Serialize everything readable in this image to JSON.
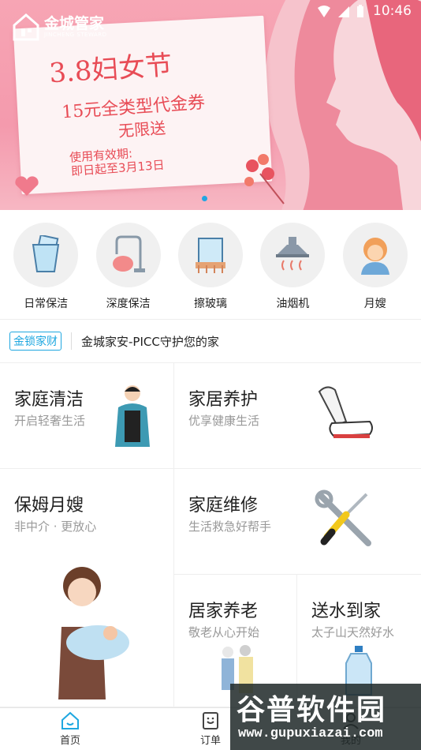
{
  "status_bar": {
    "time": "10:46"
  },
  "banner": {
    "logo_text": "金城管家",
    "logo_sub": "JINCHENG STEWARD",
    "title": "3.8妇女节",
    "line1": "15元全类型代金券",
    "line2": "无限送",
    "valid_label": "使用有效期:",
    "valid_range": "即日起至3月13日"
  },
  "categories": [
    {
      "label": "日常保洁",
      "icon": "glass-cup-icon"
    },
    {
      "label": "深度保洁",
      "icon": "vacuum-cleaner-icon"
    },
    {
      "label": "擦玻璃",
      "icon": "window-icon"
    },
    {
      "label": "油烟机",
      "icon": "range-hood-icon"
    },
    {
      "label": "月嫂",
      "icon": "nanny-avatar-icon"
    }
  ],
  "notice": {
    "badge": "金锁家财",
    "text": "金城家安-PICC守护您的家"
  },
  "services": {
    "home_cleaning": {
      "title": "家庭清洁",
      "sub": "开启轻奢生活"
    },
    "home_care": {
      "title": "家居养护",
      "sub": "优享健康生活"
    },
    "nanny": {
      "title": "保姆月嫂",
      "sub": "非中介 · 更放心"
    },
    "repair": {
      "title": "家庭维修",
      "sub": "生活救急好帮手"
    },
    "elderly": {
      "title": "居家养老",
      "sub": "敬老从心开始"
    },
    "water": {
      "title": "送水到家",
      "sub": "太子山天然好水"
    }
  },
  "tabs": [
    {
      "label": "首页",
      "icon": "home-icon"
    },
    {
      "label": "订单",
      "icon": "order-icon"
    },
    {
      "label": "我的",
      "icon": "user-icon"
    }
  ],
  "watermark": {
    "big": "谷普软件园",
    "url": "www.gupuxiazai.com"
  },
  "colors": {
    "accent": "#1ea7e0",
    "banner_pink": "#f49aad",
    "banner_red": "#e84c56"
  }
}
